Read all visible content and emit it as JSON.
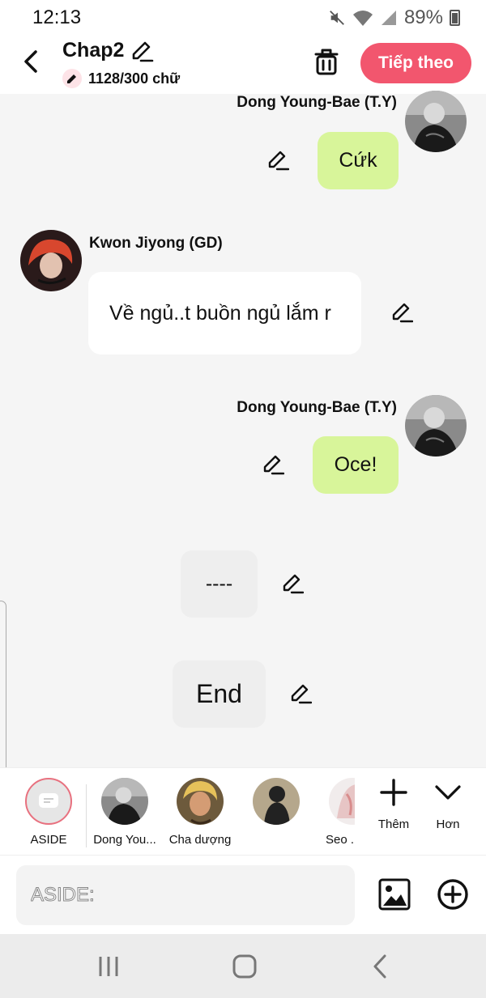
{
  "status_bar": {
    "time": "12:13",
    "battery": "89%"
  },
  "header": {
    "title": "Chap2",
    "word_count": "1128/300 chữ",
    "next_label": "Tiếp theo"
  },
  "messages": [
    {
      "speaker": "Dong Young-Bae (T.Y)",
      "text": "Cứk",
      "side": "right"
    },
    {
      "speaker": "Kwon Jiyong (GD)",
      "text": "Về ngủ..t buồn ngủ lắm r",
      "side": "left"
    },
    {
      "speaker": "Dong Young-Bae (T.Y)",
      "text": "Oce!",
      "side": "right"
    },
    {
      "text": "----",
      "type": "aside"
    },
    {
      "text": "End",
      "type": "aside"
    }
  ],
  "characters": [
    {
      "name": "ASIDE",
      "selected": true
    },
    {
      "name": "Dong Young-Bae (T.Y)",
      "display": "Dong You..."
    },
    {
      "name": "Cha dượng"
    },
    {
      "name": ""
    },
    {
      "name": "Seo",
      "display": "Seo ."
    }
  ],
  "tools": {
    "more_label": "Thêm",
    "less_label": "Hơn"
  },
  "input": {
    "placeholder": "ASIDE:"
  },
  "colors": {
    "accent": "#f2566e",
    "bubble_green": "#d8f59a",
    "aside_bubble": "#eeeeee"
  },
  "icons": [
    "back-icon",
    "pencil-icon",
    "trash-icon",
    "image-icon",
    "add-circle-icon",
    "plus-icon",
    "chevron-down-icon",
    "recents-icon",
    "home-icon",
    "nav-back-icon"
  ]
}
